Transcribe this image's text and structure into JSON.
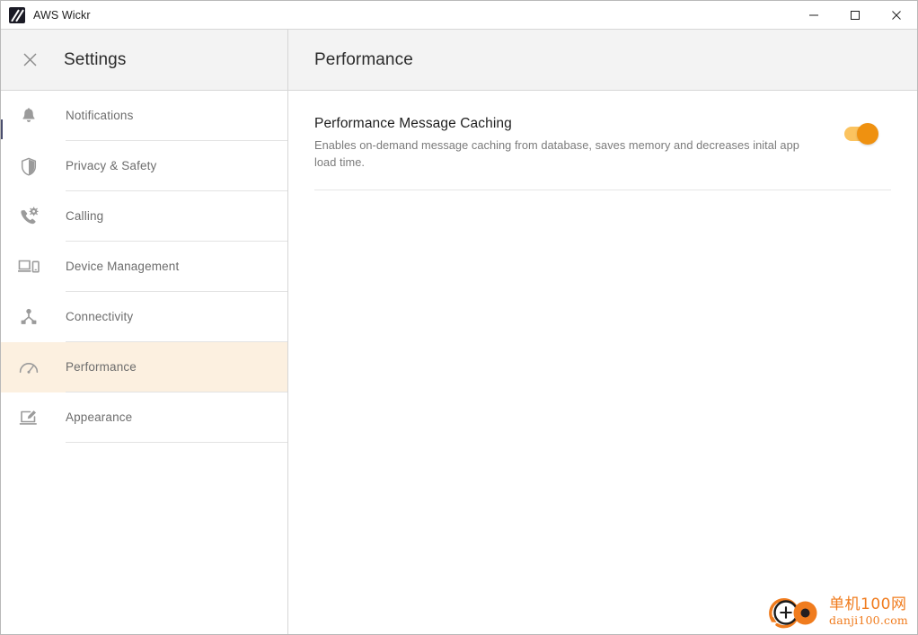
{
  "window": {
    "title": "AWS Wickr",
    "app_icon": "wickr-logo-icon",
    "controls": {
      "minimize_label": "Minimize",
      "maximize_label": "Maximize",
      "close_label": "Close"
    }
  },
  "sidebar": {
    "header": {
      "close_icon": "close-icon",
      "title": "Settings"
    },
    "items": [
      {
        "id": "notifications",
        "label": "Notifications",
        "icon": "bell-icon",
        "active": false
      },
      {
        "id": "privacy-safety",
        "label": "Privacy & Safety",
        "icon": "shield-icon",
        "active": false
      },
      {
        "id": "calling",
        "label": "Calling",
        "icon": "phone-gear-icon",
        "active": false
      },
      {
        "id": "device-management",
        "label": "Device Management",
        "icon": "devices-icon",
        "active": false
      },
      {
        "id": "connectivity",
        "label": "Connectivity",
        "icon": "network-nodes-icon",
        "active": false
      },
      {
        "id": "performance",
        "label": "Performance",
        "icon": "gauge-icon",
        "active": true
      },
      {
        "id": "appearance",
        "label": "Appearance",
        "icon": "screen-pencil-icon",
        "active": false
      }
    ]
  },
  "main": {
    "header_title": "Performance",
    "settings": [
      {
        "id": "performance-message-caching",
        "title": "Performance Message Caching",
        "description": "Enables on-demand message caching from database, saves memory and decreases inital app load time.",
        "toggle_state": "on"
      }
    ]
  },
  "watermark": {
    "cn_text": "单机100网",
    "en_text": "danji100.com",
    "mark_icon": "danji-logo-icon"
  },
  "colors": {
    "accent_orange": "#ef9110",
    "toggle_track": "#fbc35f",
    "active_row_bg": "#fcf0e0",
    "header_bg": "#f3f3f3",
    "border": "#d6d6d6",
    "text_primary": "#1f1f1f",
    "text_muted": "#7b7b7b",
    "nav_label": "#6d6d6d",
    "watermark_orange": "#f07c1e"
  }
}
